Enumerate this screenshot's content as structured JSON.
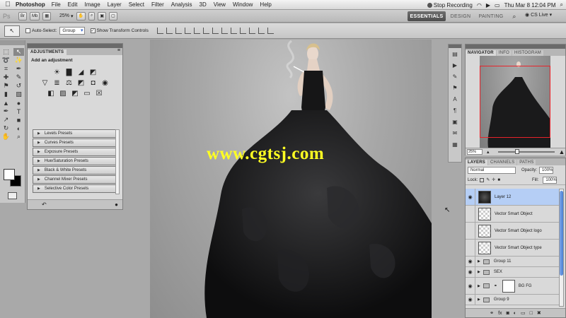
{
  "menubar": {
    "apple_icon": "apple-icon",
    "app_name": "Photoshop",
    "items": [
      "File",
      "Edit",
      "Image",
      "Layer",
      "Select",
      "Filter",
      "Analysis",
      "3D",
      "View",
      "Window",
      "Help"
    ],
    "recording": "Stop Recording",
    "clock": "Thu Mar 8  12:04 PM"
  },
  "appbar": {
    "logo": "Ps",
    "zoom": "25%",
    "workspaces": [
      "ESSENTIALS",
      "DESIGN",
      "PAINTING"
    ],
    "cs_live": "CS Live"
  },
  "options": {
    "auto_select": "Auto-Select:",
    "group_value": "Group",
    "show_transform": "Show Transform Controls"
  },
  "adjustments": {
    "tab": "ADJUSTMENTS",
    "subtitle": "Add an adjustment",
    "presets": [
      "Levels Presets",
      "Curves Presets",
      "Exposure Presets",
      "Hue/Saturation Presets",
      "Black & White Presets",
      "Channel Mixer Presets",
      "Selective Color Presets"
    ]
  },
  "canvas": {
    "watermark": "www.cgtsj.com"
  },
  "navigator": {
    "tabs": [
      "NAVIGATOR",
      "INFO",
      "HISTOGRAM"
    ],
    "zoom": "25%"
  },
  "layers": {
    "tabs": [
      "LAYERS",
      "CHANNELS",
      "PATHS"
    ],
    "blend_mode": "Normal",
    "opacity_label": "Opacity:",
    "opacity_value": "100%",
    "lock_label": "Lock:",
    "fill_label": "Fill:",
    "fill_value": "100%",
    "items": [
      {
        "name": "Layer 12"
      },
      {
        "name": "Vector Smart Object"
      },
      {
        "name": "Vector Smart Object logo"
      },
      {
        "name": "Vector Smart Object type"
      },
      {
        "name": "Group 11"
      },
      {
        "name": "SEX"
      },
      {
        "name": "BG FG"
      },
      {
        "name": "Group 9"
      }
    ]
  },
  "colors": {
    "accent": "#3764c7",
    "selected_layer": "#b5cef5",
    "watermark": "#ffff22"
  }
}
